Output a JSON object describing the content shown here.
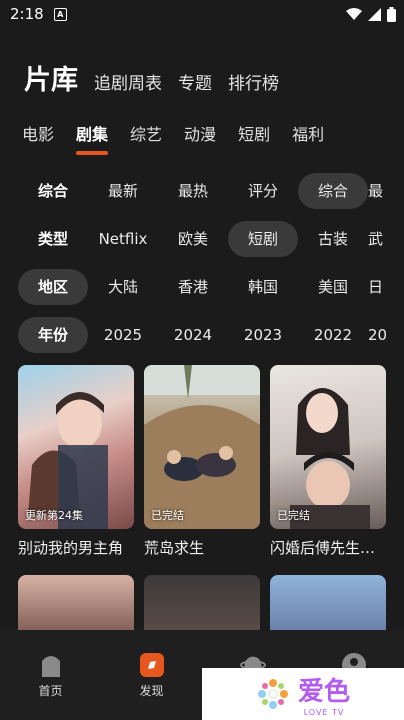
{
  "status": {
    "time": "2:18",
    "notif_icon": "A"
  },
  "header": {
    "title": "片库",
    "tabs": [
      "追剧周表",
      "专题",
      "排行榜"
    ]
  },
  "categories": [
    {
      "label": "电影",
      "active": false
    },
    {
      "label": "剧集",
      "active": true
    },
    {
      "label": "综艺",
      "active": false
    },
    {
      "label": "动漫",
      "active": false
    },
    {
      "label": "短剧",
      "active": false
    },
    {
      "label": "福利",
      "active": false
    }
  ],
  "filters": {
    "sort": {
      "title": "综合",
      "options": [
        "最新",
        "最热",
        "评分",
        "综合",
        "最"
      ],
      "selected": "综合"
    },
    "type": {
      "title": "类型",
      "options": [
        "Netflix",
        "欧美",
        "短剧",
        "古装",
        "武"
      ],
      "selected": "短剧"
    },
    "region": {
      "title": "地区",
      "options": [
        "大陆",
        "香港",
        "韩国",
        "美国",
        "日"
      ],
      "selected": "地区"
    },
    "year": {
      "title": "年份",
      "options": [
        "2025",
        "2024",
        "2023",
        "2022",
        "20"
      ],
      "selected": "年份"
    }
  },
  "cards": [
    {
      "title": "别动我的男主角",
      "badge": "更新第24集"
    },
    {
      "title": "荒岛求生",
      "badge": "已完结"
    },
    {
      "title": "闪婚后傅先生…",
      "badge": "已完结"
    }
  ],
  "nav": [
    {
      "label": "首页",
      "icon": "home-icon"
    },
    {
      "label": "发现",
      "icon": "discover-icon"
    },
    {
      "label": "",
      "icon": "planet-icon"
    },
    {
      "label": "",
      "icon": "user-icon"
    }
  ],
  "watermark": {
    "text": "爱色",
    "sub": "LOVE TV"
  },
  "colors": {
    "accent": "#e8571f",
    "background": "#1b1b1b",
    "chip_selected": "#3a3a3a"
  }
}
